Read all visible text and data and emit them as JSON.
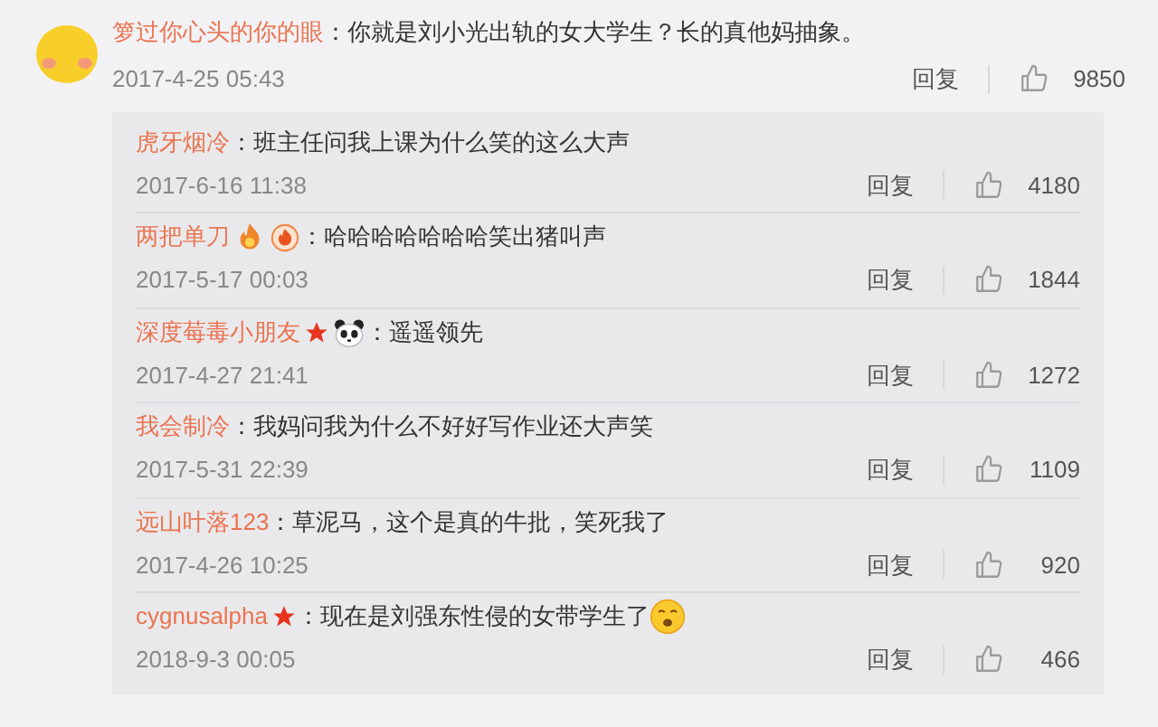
{
  "comment": {
    "author": "箩过你心头的你的眼",
    "separator": "：",
    "text": "你就是刘小光出轨的女大学生？长的真他妈抽象。",
    "date": "2017-4-25 05:43",
    "reply_label": "回复",
    "likes": "9850"
  },
  "replies": [
    {
      "author": "虎牙烟冷",
      "separator": "：",
      "text": "班主任问我上课为什么笑的这么大声",
      "text_emoji": false,
      "date": "2017-6-16 11:38",
      "reply_label": "回复",
      "likes": "4180"
    },
    {
      "author": "两把单刀",
      "badges": [
        {
          "kind": "flame"
        },
        {
          "kind": "fire-ball"
        }
      ],
      "separator": "：",
      "text": "哈哈哈哈哈哈哈笑出猪叫声",
      "text_emoji": false,
      "date": "2017-5-17 00:03",
      "reply_label": "回复",
      "likes": "1844"
    },
    {
      "author": "深度莓毒小朋友",
      "badges": [
        {
          "kind": "star"
        },
        {
          "kind": "panda"
        }
      ],
      "separator": "：",
      "text": "遥遥领先",
      "text_emoji": false,
      "date": "2017-4-27 21:41",
      "reply_label": "回复",
      "likes": "1272"
    },
    {
      "author": "我会制冷",
      "separator": "：",
      "text": "我妈问我为什么不好好写作业还大声笑",
      "text_emoji": false,
      "date": "2017-5-31 22:39",
      "reply_label": "回复",
      "likes": "1109"
    },
    {
      "author": "远山叶落123",
      "separator": "：",
      "text": "草泥马，这个是真的牛批，笑死我了",
      "text_emoji": false,
      "date": "2017-4-26 10:25",
      "reply_label": "回复",
      "likes": "920"
    },
    {
      "author": "cygnusalpha",
      "badges": [
        {
          "kind": "star"
        }
      ],
      "separator": "：",
      "text": "现在是刘强东性侵的女带学生了",
      "text_emoji": true,
      "date": "2018-9-3 00:05",
      "reply_label": "回复",
      "likes": "466"
    }
  ]
}
